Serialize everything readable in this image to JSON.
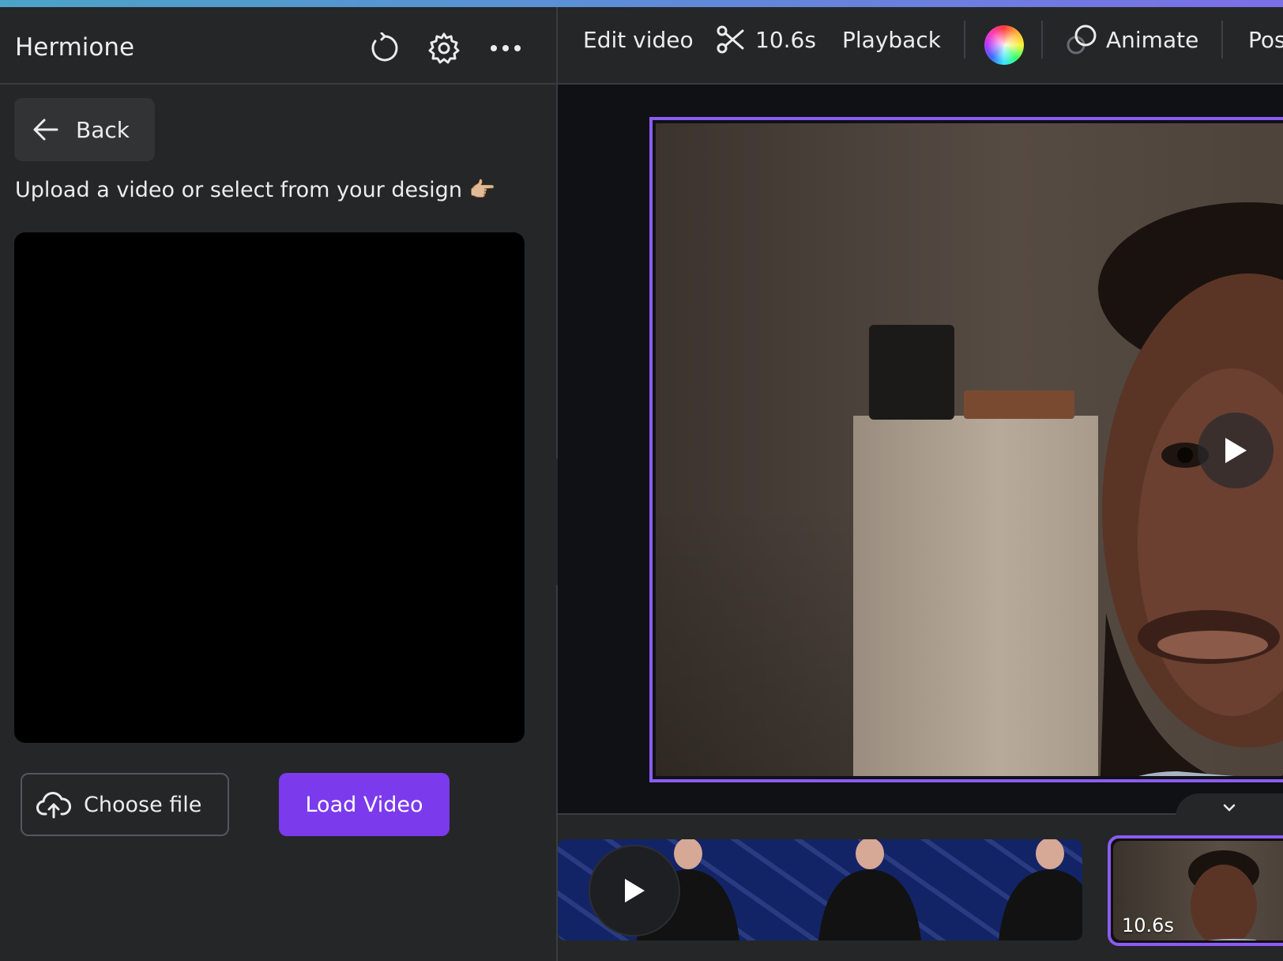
{
  "app": {
    "panel_title": "Hermione"
  },
  "header_icons": {
    "refresh": "refresh-icon",
    "settings": "gear-icon",
    "more": "more-horizontal-icon"
  },
  "left_panel": {
    "back_label": "Back",
    "instruction": "Upload a video or select from your design 👉🏼",
    "choose_file_label": "Choose file",
    "load_video_label": "Load Video"
  },
  "toolbar": {
    "edit_video": "Edit video",
    "duration": "10.6s",
    "playback": "Playback",
    "animate": "Animate",
    "position": "Pos"
  },
  "timeline": {
    "selected_clip_duration": "10.6s"
  },
  "colors": {
    "accent_purple": "#7c3aed",
    "frame_border": "#8b5cf6",
    "panel_bg": "#252627",
    "canvas_bg": "#0f1115"
  }
}
